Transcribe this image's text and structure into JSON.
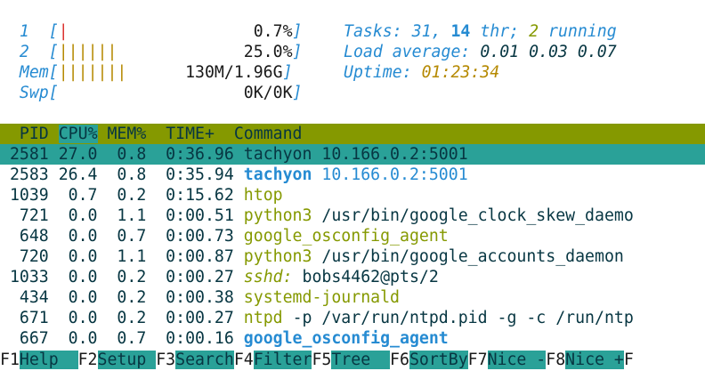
{
  "meters": {
    "cpu1": {
      "label": "1",
      "bars": "|",
      "value": "0.7%"
    },
    "cpu2": {
      "label": "2",
      "bars": "||||||",
      "value": "25.0%"
    },
    "mem": {
      "label": "Mem",
      "bars": "|||||||",
      "value": "130M/1.96G"
    },
    "swp": {
      "label": "Swp",
      "bars": "",
      "value": "0K/0K"
    }
  },
  "summary": {
    "tasks_label": "Tasks:",
    "tasks": "31",
    "threads": "14",
    "thr_label": "thr;",
    "running": "2",
    "running_label": "running",
    "load_label": "Load average:",
    "load1": "0.01",
    "load5": "0.03",
    "load15": "0.07",
    "uptime_label": "Uptime:",
    "uptime": "01:23:34"
  },
  "columns": {
    "pid": "PID",
    "cpu": "CPU%",
    "mem": "MEM%",
    "time": "TIME+",
    "command": "Command"
  },
  "processes": [
    {
      "pid": "2581",
      "cpu": "27.0",
      "mem": "0.8",
      "time": "0:36.96",
      "cmd": "tachyon",
      "args": "10.166.0.2:5001"
    },
    {
      "pid": "2583",
      "cpu": "26.4",
      "mem": "0.8",
      "time": "0:35.94",
      "cmd": "tachyon",
      "args": "10.166.0.2:5001"
    },
    {
      "pid": "1039",
      "cpu": "0.7",
      "mem": "0.2",
      "time": "0:15.62",
      "cmd": "htop",
      "args": ""
    },
    {
      "pid": "721",
      "cpu": "0.0",
      "mem": "1.1",
      "time": "0:00.51",
      "cmd": "python3",
      "args": "/usr/bin/google_clock_skew_daemo"
    },
    {
      "pid": "648",
      "cpu": "0.0",
      "mem": "0.7",
      "time": "0:00.73",
      "cmd": "google_osconfig_agent",
      "args": ""
    },
    {
      "pid": "720",
      "cpu": "0.0",
      "mem": "1.1",
      "time": "0:00.87",
      "cmd": "python3",
      "args": "/usr/bin/google_accounts_daemon"
    },
    {
      "pid": "1033",
      "cpu": "0.0",
      "mem": "0.2",
      "time": "0:00.27",
      "cmd": "sshd:",
      "args": "bobs4462@pts/2"
    },
    {
      "pid": "434",
      "cpu": "0.0",
      "mem": "0.2",
      "time": "0:00.38",
      "cmd": "systemd-journald",
      "args": ""
    },
    {
      "pid": "671",
      "cpu": "0.0",
      "mem": "0.2",
      "time": "0:00.27",
      "cmd": "ntpd",
      "args": "-p /var/run/ntpd.pid -g -c /run/ntp"
    },
    {
      "pid": "667",
      "cpu": "0.0",
      "mem": "0.7",
      "time": "0:00.16",
      "cmd": "google_osconfig_agent",
      "args": ""
    }
  ],
  "fkeys": [
    {
      "key": "F1",
      "label": "Help  "
    },
    {
      "key": "F2",
      "label": "Setup "
    },
    {
      "key": "F3",
      "label": "Search"
    },
    {
      "key": "F4",
      "label": "Filter"
    },
    {
      "key": "F5",
      "label": "Tree  "
    },
    {
      "key": "F6",
      "label": "SortBy"
    },
    {
      "key": "F7",
      "label": "Nice -"
    },
    {
      "key": "F8",
      "label": "Nice +"
    },
    {
      "key": "F",
      "label": ""
    }
  ],
  "colors": {
    "cyan": "#2aa198",
    "green": "#859900",
    "blue": "#268bd2",
    "yellow": "#b58900",
    "red": "#dc322f"
  }
}
